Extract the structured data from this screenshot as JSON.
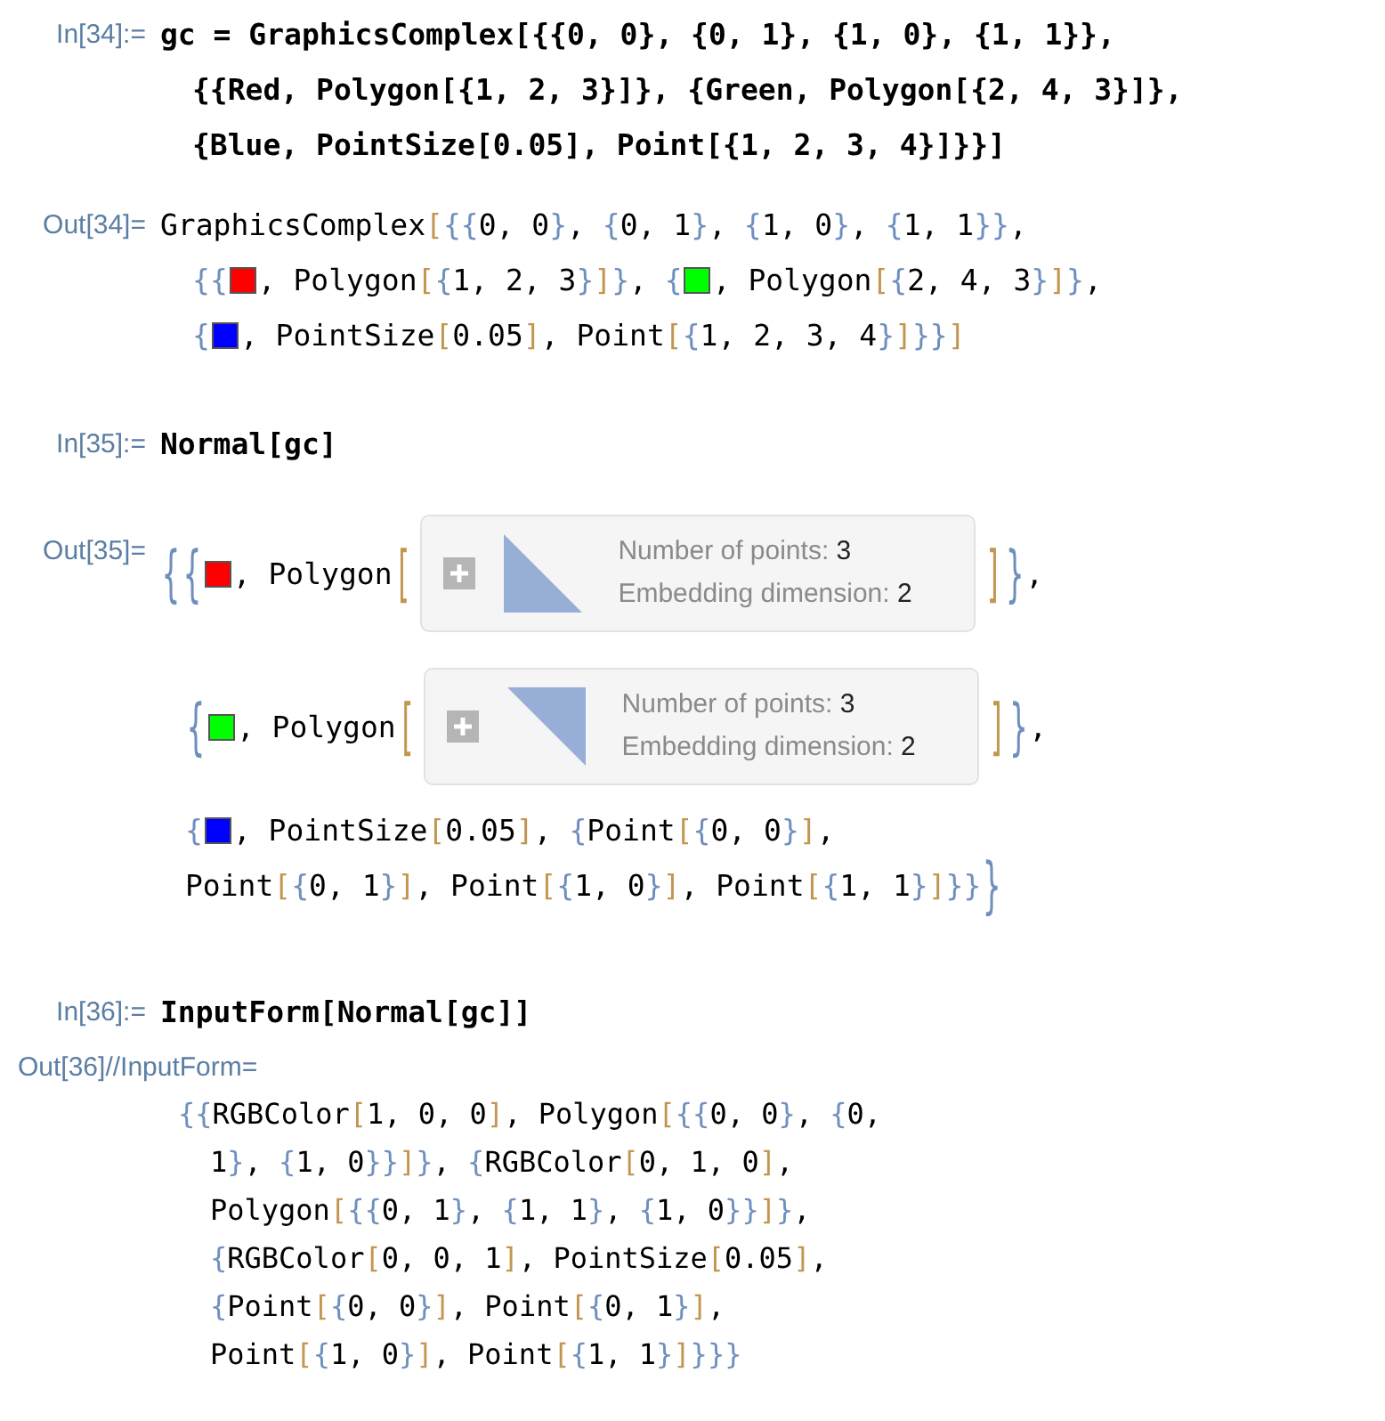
{
  "cells": [
    {
      "label": "In[34]:=",
      "kind": "input",
      "lines": [
        [
          {
            "kind": "text",
            "text": "gc = GraphicsComplex[{{0, 0}, {0, 1}, {1, 0}, {1, 1}},"
          }
        ],
        [
          {
            "kind": "text",
            "text": "{{Red, Polygon[{1, 2, 3}]}, {Green, Polygon[{2, 4, 3}]},"
          }
        ],
        [
          {
            "kind": "text",
            "text": "{Blue, PointSize[0.05], Point[{1, 2, 3, 4}]}}]"
          }
        ]
      ]
    },
    {
      "label": "Out[34]=",
      "kind": "output",
      "lines": [
        [
          {
            "kind": "text",
            "text": "GraphicsComplex[{{0, 0}, {0, 1}, {1, 0}, {1, 1}},"
          }
        ],
        [
          {
            "kind": "text",
            "text": "{{"
          },
          {
            "kind": "swatch",
            "color": "#ff0000"
          },
          {
            "kind": "text",
            "text": ", Polygon[{1, 2, 3}]}, {"
          },
          {
            "kind": "swatch",
            "color": "#00ff00"
          },
          {
            "kind": "text",
            "text": ", Polygon[{2, 4, 3}]},"
          }
        ],
        [
          {
            "kind": "text",
            "text": "{"
          },
          {
            "kind": "swatch",
            "color": "#0000ff"
          },
          {
            "kind": "text",
            "text": ", PointSize[0.05], Point[{1, 2, 3, 4}]}}]"
          }
        ]
      ]
    },
    {
      "label": "In[35]:=",
      "kind": "input",
      "lines": [
        [
          {
            "kind": "text",
            "text": "Normal[gc]"
          }
        ]
      ]
    },
    {
      "label": "Out[35]=",
      "kind": "output",
      "lines": [
        [
          {
            "kind": "tall",
            "text": "{"
          },
          {
            "kind": "tall",
            "text": "{"
          },
          {
            "kind": "swatch",
            "color": "#ff0000"
          },
          {
            "kind": "text",
            "text": ", Polygon"
          },
          {
            "kind": "tall",
            "text": "["
          },
          {
            "kind": "summary_lower_left",
            "rows": [
              {
                "label": "Number of points:",
                "value": "3"
              },
              {
                "label": "Embedding dimension:",
                "value": "2"
              }
            ]
          },
          {
            "kind": "tall",
            "text": "]"
          },
          {
            "kind": "tall",
            "text": "}"
          },
          {
            "kind": "text",
            "text": ","
          }
        ],
        [
          {
            "kind": "tall",
            "text": "{"
          },
          {
            "kind": "swatch",
            "color": "#00ff00"
          },
          {
            "kind": "text",
            "text": ", Polygon"
          },
          {
            "kind": "tall",
            "text": "["
          },
          {
            "kind": "summary_upper_right",
            "rows": [
              {
                "label": "Number of points:",
                "value": "3"
              },
              {
                "label": "Embedding dimension:",
                "value": "2"
              }
            ]
          },
          {
            "kind": "tall",
            "text": "]"
          },
          {
            "kind": "tall",
            "text": "}"
          },
          {
            "kind": "text",
            "text": ","
          }
        ],
        [
          {
            "kind": "text",
            "text": "{"
          },
          {
            "kind": "swatch",
            "color": "#0000ff"
          },
          {
            "kind": "text",
            "text": ", PointSize[0.05], {Point[{0, 0}],"
          }
        ],
        [
          {
            "kind": "text",
            "text": "Point[{0, 1}], Point[{1, 0}], Point[{1, 1}]}}"
          },
          {
            "kind": "tall",
            "text": "}"
          }
        ]
      ]
    },
    {
      "label": "In[36]:=",
      "kind": "input",
      "lines": [
        [
          {
            "kind": "text",
            "text": "InputForm[Normal[gc]]"
          }
        ]
      ]
    },
    {
      "label": "Out[36]//InputForm=",
      "kind": "output_block",
      "lines": [
        [
          {
            "kind": "text",
            "text": "{{RGBColor[1, 0, 0], Polygon[{{0, 0}, {0,"
          }
        ],
        [
          {
            "kind": "text",
            "text": "1}, {1, 0}}]}, {RGBColor[0, 1, 0],"
          }
        ],
        [
          {
            "kind": "text",
            "text": "Polygon[{{0, 1}, {1, 1}, {1, 0}}]},"
          }
        ],
        [
          {
            "kind": "text",
            "text": "{RGBColor[0, 0, 1], PointSize[0.05],"
          }
        ],
        [
          {
            "kind": "text",
            "text": "{Point[{0, 0}], Point[{0, 1}],"
          }
        ],
        [
          {
            "kind": "text",
            "text": "Point[{1, 0}], Point[{1, 1}]}}}"
          }
        ]
      ]
    }
  ]
}
